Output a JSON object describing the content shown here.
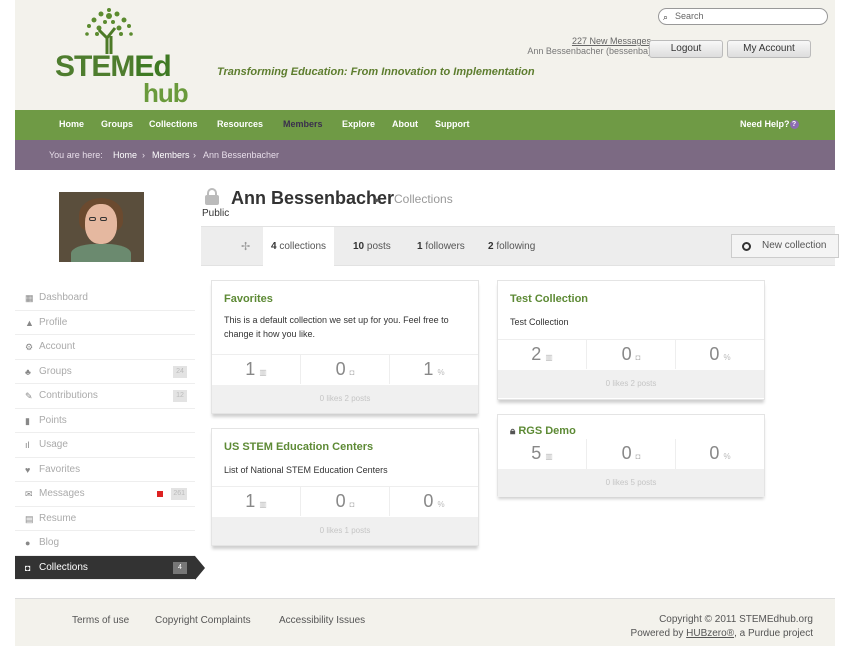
{
  "header": {
    "logo_stem": "STEM",
    "logo_d": "Ed",
    "logo_hub": "hub",
    "tagline": "Transforming Education: From Innovation to Implementation",
    "search_placeholder": "Search",
    "new_messages": "227 New Messages",
    "user": "Ann Bessenbacher (bessenba)",
    "logout": "Logout",
    "my_account": "My Account"
  },
  "nav": {
    "items": [
      "Home",
      "Groups",
      "Collections",
      "Resources",
      "Members",
      "Explore",
      "About",
      "Support"
    ],
    "help": "Need Help?"
  },
  "breadcrumb": {
    "prefix": "You are here:",
    "home": "Home",
    "sep": "›",
    "members": "Members",
    "current": "Ann Bessenbacher"
  },
  "profile": {
    "name": "Ann Bessenbacher",
    "section": "Collections",
    "visibility": "Public"
  },
  "sidebar": [
    {
      "label": "Dashboard",
      "icon": "▦"
    },
    {
      "label": "Profile",
      "icon": "▲"
    },
    {
      "label": "Account",
      "icon": "⚙"
    },
    {
      "label": "Groups",
      "icon": "♣",
      "count": "24"
    },
    {
      "label": "Contributions",
      "icon": "✎",
      "count": "12"
    },
    {
      "label": "Points",
      "icon": "▮"
    },
    {
      "label": "Usage",
      "icon": "ıl"
    },
    {
      "label": "Favorites",
      "icon": "♥"
    },
    {
      "label": "Messages",
      "icon": "✉",
      "count": "261"
    },
    {
      "label": "Resume",
      "icon": "▤"
    },
    {
      "label": "Blog",
      "icon": "●"
    },
    {
      "label": "Collections",
      "icon": "◘",
      "count": "4"
    }
  ],
  "tabs": {
    "collections_num": "4",
    "collections_label": "collections",
    "posts_num": "10",
    "posts_label": "posts",
    "followers_num": "1",
    "followers_label": "followers",
    "following_num": "2",
    "following_label": "following",
    "new_collection": "New collection"
  },
  "cards": [
    {
      "title": "Favorites",
      "desc": "This is a default collection we set up for you. Feel free to change it how you like.",
      "posts": "1",
      "likes_n": "0",
      "follow": "1",
      "footer": "0 likes   2 posts"
    },
    {
      "title": "Test Collection",
      "desc": "Test Collection",
      "posts": "2",
      "likes_n": "0",
      "follow": "0",
      "footer": "0 likes   2 posts"
    },
    {
      "title": "US STEM Education Centers",
      "desc": "List of National STEM Education Centers",
      "posts": "1",
      "likes_n": "0",
      "follow": "0",
      "footer": "0 likes   1 posts"
    },
    {
      "title": "RGS Demo",
      "desc": "",
      "posts": "5",
      "likes_n": "0",
      "follow": "0",
      "footer": "0 likes   5 posts"
    }
  ],
  "footer": {
    "terms": "Terms of use",
    "copyright_complaints": "Copyright Complaints",
    "accessibility": "Accessibility Issues",
    "copyright": "Copyright © 2011 STEMEdhub.org",
    "powered_prefix": "Powered by",
    "hubzero": "HUBzero®",
    "powered_suffix": ", a Purdue project"
  }
}
